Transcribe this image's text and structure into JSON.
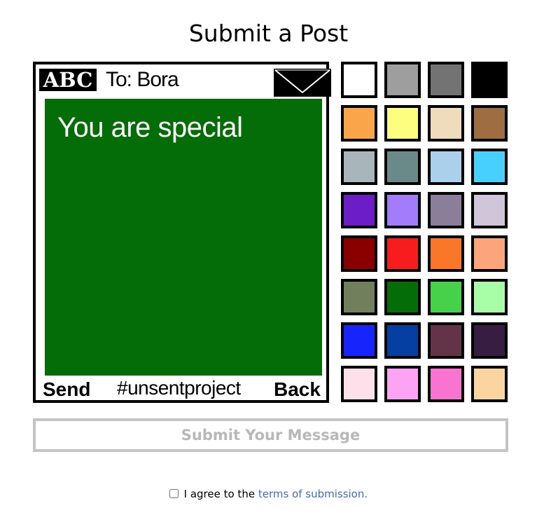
{
  "page": {
    "title": "Submit a Post"
  },
  "phone": {
    "logo_text": "ABC",
    "to_label": "To: Bora",
    "message": "You are special",
    "message_bg_color": "#056d07",
    "send_label": "Send",
    "hashtag": "#unsentproject",
    "back_label": "Back",
    "envelope_icon": "envelope-icon"
  },
  "palette": {
    "colors": [
      "#ffffff",
      "#9e9e9e",
      "#737373",
      "#000000",
      "#fba54b",
      "#fdfd80",
      "#eedcbc",
      "#9e6d42",
      "#a8b6bb",
      "#6a8a8a",
      "#aad0ec",
      "#47d0fd",
      "#6c1dc8",
      "#a27cfa",
      "#8a7e98",
      "#d1c6d9",
      "#8a0000",
      "#f81c1e",
      "#fa7628",
      "#fca47c",
      "#717f5c",
      "#056d07",
      "#47d049",
      "#a8fda7",
      "#1724fb",
      "#053fa1",
      "#633348",
      "#371d42",
      "#fde0ea",
      "#fca3f5",
      "#f973d1",
      "#fbd4a0"
    ],
    "selected": "#056d07"
  },
  "submit": {
    "label": "Submit Your Message"
  },
  "terms": {
    "prefix": "I agree to the ",
    "link_text": "terms of submission.",
    "checked": false
  }
}
